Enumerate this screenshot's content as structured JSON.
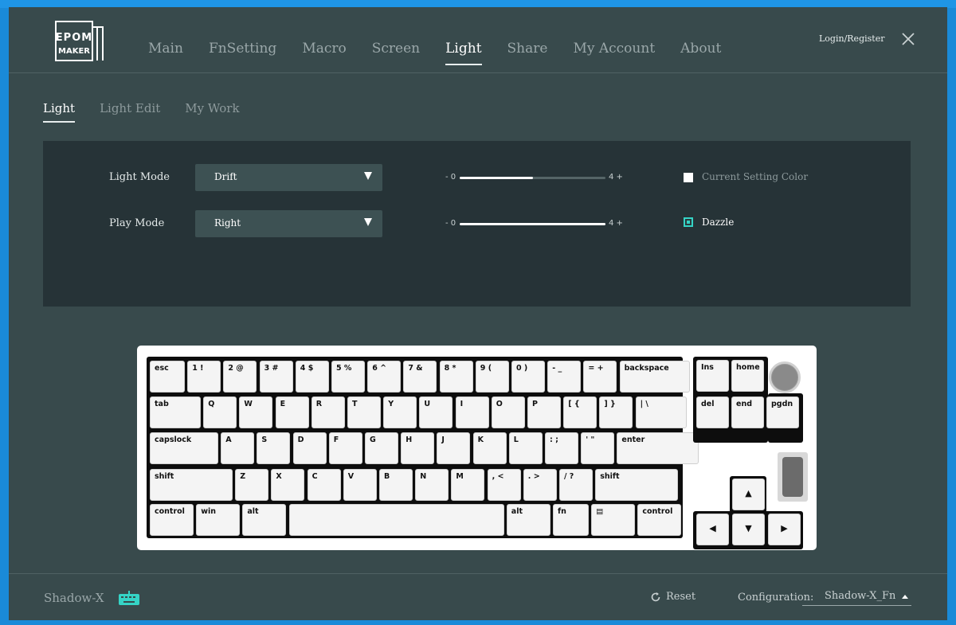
{
  "brand": {
    "logo_text_top": "EPOM",
    "logo_text_bottom": "MAKER"
  },
  "nav": {
    "items": [
      "Main",
      "FnSetting",
      "Macro",
      "Screen",
      "Light",
      "Share",
      "My Account",
      "About"
    ],
    "active": "Light"
  },
  "header": {
    "login_label": "Login/Register"
  },
  "subtabs": {
    "items": [
      "Light",
      "Light Edit",
      "My Work"
    ],
    "active": "Light"
  },
  "light": {
    "light_mode_label": "Light Mode",
    "light_mode_value": "Drift",
    "play_mode_label": "Play Mode",
    "play_mode_value": "Right",
    "slider1": {
      "min_label": "- 0",
      "max_label": "4 +",
      "value": 2,
      "max": 4
    },
    "slider2": {
      "min_label": "- 0",
      "max_label": "4 +",
      "value": 4,
      "max": 4
    },
    "current_color_label": "Current Setting Color",
    "current_color_checked": false,
    "dazzle_label": "Dazzle",
    "dazzle_checked": true
  },
  "keyboard": {
    "rows": [
      [
        "esc",
        "1 !",
        "2 @",
        "3 #",
        "4 $",
        "5 %",
        "6 ^",
        "7 &",
        "8 *",
        "9 (",
        "0 )",
        "- _",
        "= +",
        "backspace"
      ],
      [
        "tab",
        "Q",
        "W",
        "E",
        "R",
        "T",
        "Y",
        "U",
        "I",
        "O",
        "P",
        "[ {",
        "] }",
        "| \\"
      ],
      [
        "capslock",
        "A",
        "S",
        "D",
        "F",
        "G",
        "H",
        "J",
        "K",
        "L",
        ": ;",
        "' \"",
        "enter"
      ],
      [
        "shift",
        "Z",
        "X",
        "C",
        "V",
        "B",
        "N",
        "M",
        ", <",
        ". >",
        "/ ?",
        "shift"
      ],
      [
        "control",
        "win",
        "alt",
        "",
        "alt",
        "fn",
        "▤",
        "control"
      ]
    ],
    "nav_cluster": [
      "Ins",
      "home",
      "del",
      "end",
      "pgdn"
    ],
    "arrows": {
      "up": "▲",
      "left": "◀",
      "down": "▼",
      "right": "▶"
    }
  },
  "footer": {
    "device_name": "Shadow-X",
    "reset_label": "Reset",
    "configuration_label": "Configuration:",
    "configuration_value": "Shadow-X_Fn"
  },
  "colors": {
    "accent": "#35d4c6",
    "window_bg": "#384a4c",
    "panel_bg": "#263337"
  }
}
